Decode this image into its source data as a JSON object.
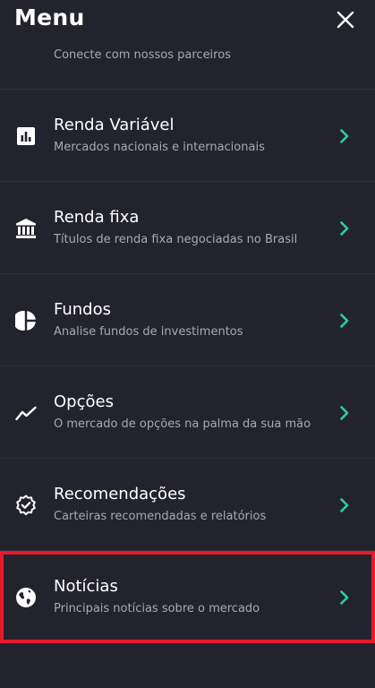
{
  "header": {
    "title": "Menu",
    "close_icon": "close-icon"
  },
  "partial_item": {
    "subtitle": "Conecte com nossos parceiros"
  },
  "menu": {
    "accent_color": "#29d19c",
    "items": [
      {
        "label": "Renda Variável",
        "subtitle": "Mercados nacionais e internacionais",
        "icon": "bar-chart-icon"
      },
      {
        "label": "Renda fixa",
        "subtitle": "Títulos de renda fixa negociadas no Brasil",
        "icon": "bank-icon"
      },
      {
        "label": "Fundos",
        "subtitle": "Analise fundos de investimentos",
        "icon": "pie-chart-icon"
      },
      {
        "label": "Opções",
        "subtitle": "O mercado de opções na palma da sua mão",
        "icon": "trend-line-icon"
      },
      {
        "label": "Recomendações",
        "subtitle": "Carteiras recomendadas e relatórios",
        "icon": "verified-badge-icon"
      },
      {
        "label": "Notícias",
        "subtitle": "Principais notícias sobre o mercado",
        "icon": "globe-icon"
      }
    ]
  },
  "highlight_color": "#e51a2a"
}
